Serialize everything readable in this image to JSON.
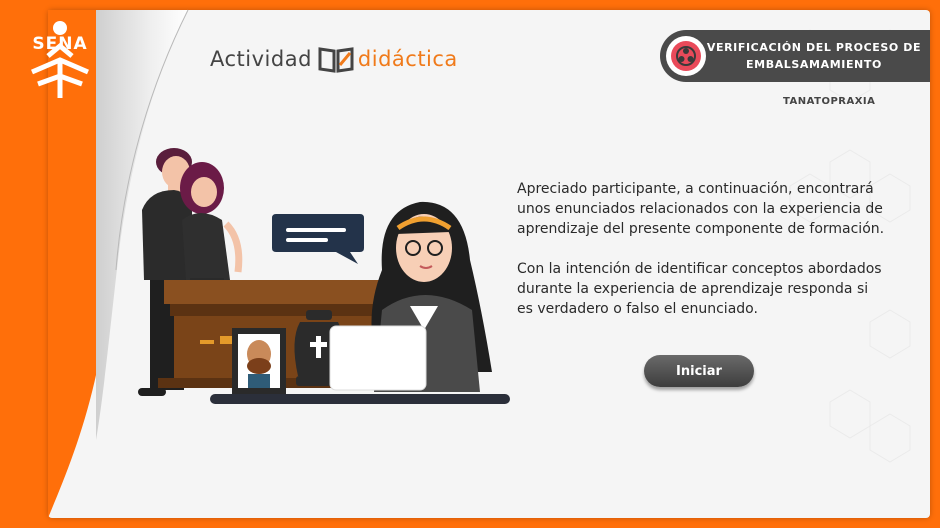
{
  "brand": {
    "logo_text": "SENA"
  },
  "header": {
    "title_part1": "Actividad",
    "title_part2": "didáctica",
    "topic_line1": "VERIFICACIÓN DEL PROCESO DE",
    "topic_line2": "EMBALSAMAMIENTO",
    "subject": "TANATOPRAXIA"
  },
  "main": {
    "paragraph1": "Apreciado participante, a continuación, encontrará unos enunciados relacionados con la experiencia de aprendizaje del presente componente de formación.",
    "paragraph2": "Con la intención de identificar conceptos abordados durante la experiencia de aprendizaje responda si es verdadero o falso el enunciado.",
    "start_button": "Iniciar"
  },
  "colors": {
    "frame": "#ff6f0a",
    "accent": "#f07a1a",
    "dark": "#4a4a4a"
  },
  "icons": [
    "sena-logo",
    "book-icon",
    "biohazard-icon",
    "chat-bubble-icon",
    "cross-icon"
  ]
}
